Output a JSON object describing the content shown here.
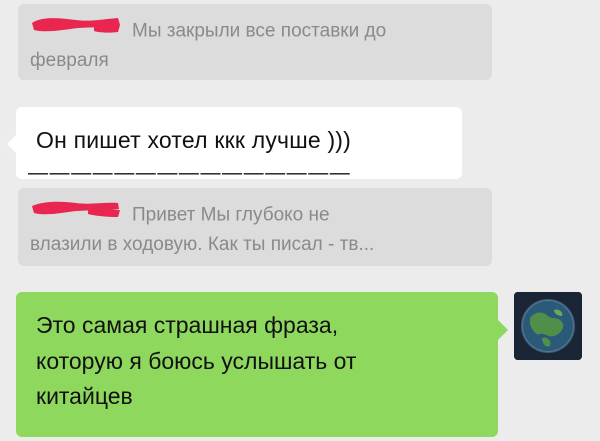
{
  "messages": {
    "quote_1": {
      "line1": "Мы закрыли все поставки до",
      "line2": "февраля"
    },
    "incoming": {
      "text": "Он пишет хотел ккк лучше )))",
      "dashes": "— — — — — — — — — — — — — — —"
    },
    "quote_2": {
      "line1": "Привет  Мы глубоко не",
      "line2": "влазили в ходовую. Как ты писал - тв..."
    },
    "outgoing": {
      "line1": "Это самая страшная фраза,",
      "line2": "которую я боюсь услышать от",
      "line3": "китайцев"
    }
  },
  "colors": {
    "background": "#ececec",
    "quote_bg": "#dcdcdc",
    "quote_text": "#8a8a8a",
    "outgoing_bg": "#8ed85e",
    "redaction": "#e8264f"
  },
  "icons": {
    "redaction_1": "redaction-scribble-icon",
    "redaction_2": "redaction-scribble-icon",
    "avatar": "earth-avatar"
  }
}
